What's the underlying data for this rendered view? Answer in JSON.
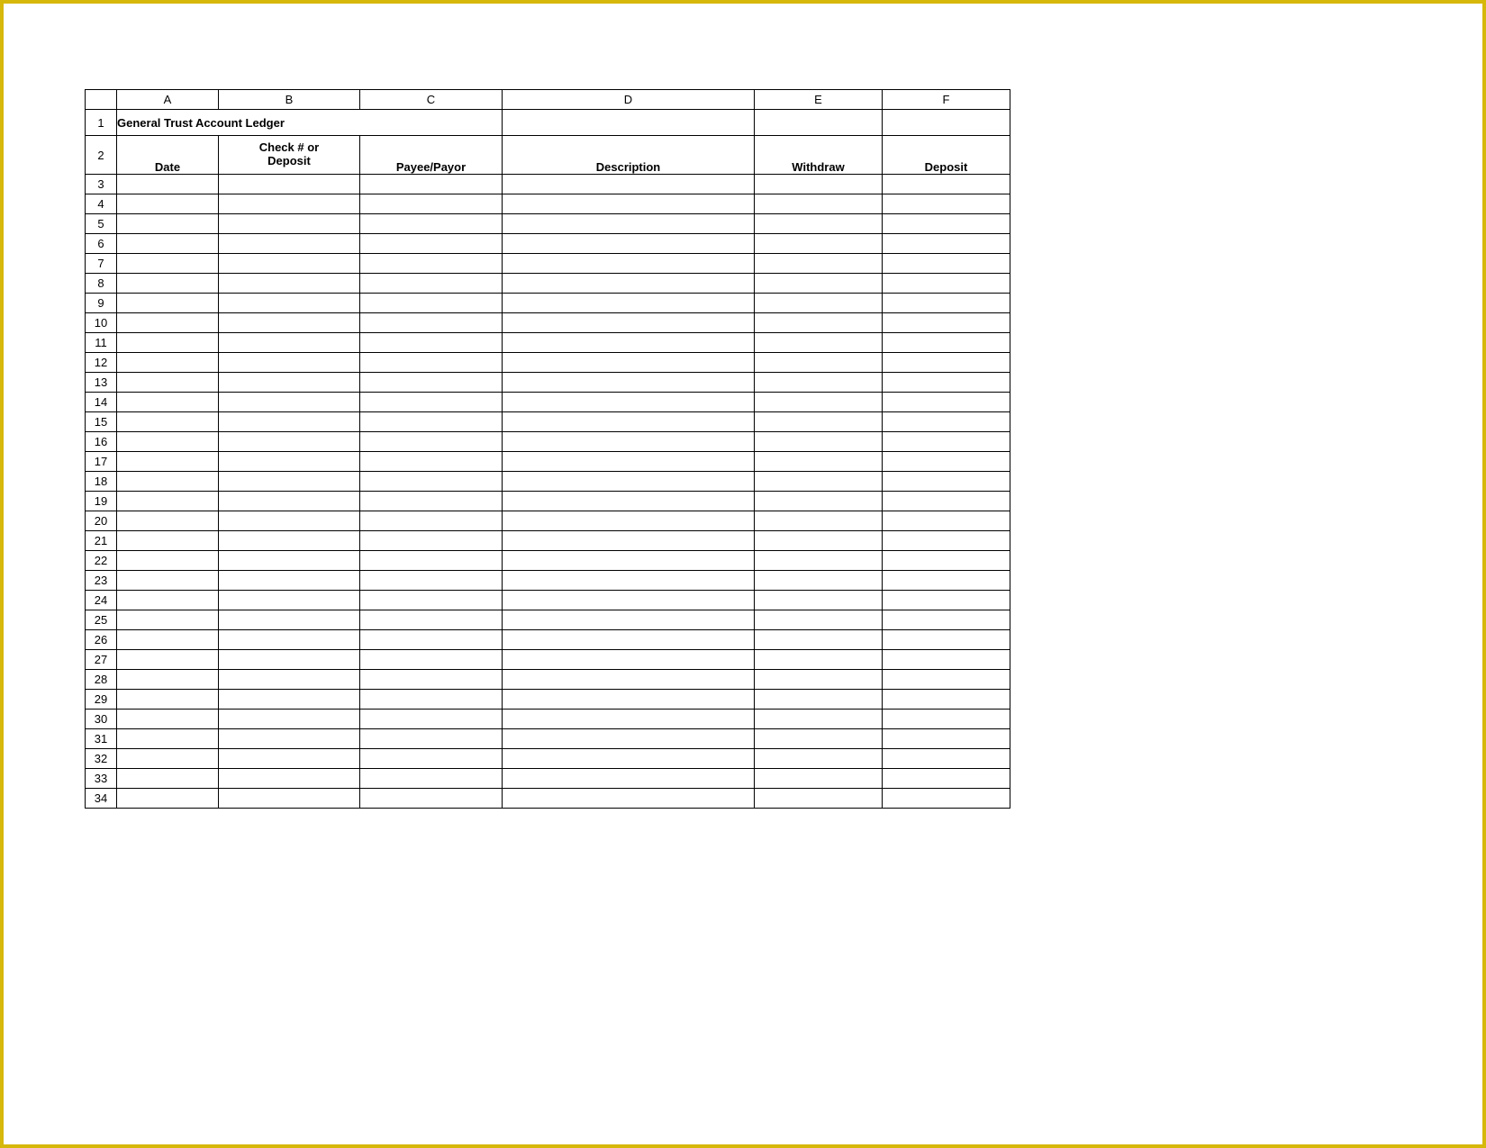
{
  "columnLetters": [
    "A",
    "B",
    "C",
    "D",
    "E",
    "F"
  ],
  "title": "General Trust Account Ledger",
  "headers": {
    "A": "Date",
    "B": "Check # or\nDeposit",
    "C": "Payee/Payor",
    "D": "Description",
    "E": "Withdraw",
    "F": "Deposit"
  },
  "rowNumbers": {
    "title": "1",
    "header": "2",
    "dataStart": 3,
    "dataEnd": 34
  },
  "rows": [
    {
      "A": "",
      "B": "",
      "C": "",
      "D": "",
      "E": "",
      "F": ""
    },
    {
      "A": "",
      "B": "",
      "C": "",
      "D": "",
      "E": "",
      "F": ""
    },
    {
      "A": "",
      "B": "",
      "C": "",
      "D": "",
      "E": "",
      "F": ""
    },
    {
      "A": "",
      "B": "",
      "C": "",
      "D": "",
      "E": "",
      "F": ""
    },
    {
      "A": "",
      "B": "",
      "C": "",
      "D": "",
      "E": "",
      "F": ""
    },
    {
      "A": "",
      "B": "",
      "C": "",
      "D": "",
      "E": "",
      "F": ""
    },
    {
      "A": "",
      "B": "",
      "C": "",
      "D": "",
      "E": "",
      "F": ""
    },
    {
      "A": "",
      "B": "",
      "C": "",
      "D": "",
      "E": "",
      "F": ""
    },
    {
      "A": "",
      "B": "",
      "C": "",
      "D": "",
      "E": "",
      "F": ""
    },
    {
      "A": "",
      "B": "",
      "C": "",
      "D": "",
      "E": "",
      "F": ""
    },
    {
      "A": "",
      "B": "",
      "C": "",
      "D": "",
      "E": "",
      "F": ""
    },
    {
      "A": "",
      "B": "",
      "C": "",
      "D": "",
      "E": "",
      "F": ""
    },
    {
      "A": "",
      "B": "",
      "C": "",
      "D": "",
      "E": "",
      "F": ""
    },
    {
      "A": "",
      "B": "",
      "C": "",
      "D": "",
      "E": "",
      "F": ""
    },
    {
      "A": "",
      "B": "",
      "C": "",
      "D": "",
      "E": "",
      "F": ""
    },
    {
      "A": "",
      "B": "",
      "C": "",
      "D": "",
      "E": "",
      "F": ""
    },
    {
      "A": "",
      "B": "",
      "C": "",
      "D": "",
      "E": "",
      "F": ""
    },
    {
      "A": "",
      "B": "",
      "C": "",
      "D": "",
      "E": "",
      "F": ""
    },
    {
      "A": "",
      "B": "",
      "C": "",
      "D": "",
      "E": "",
      "F": ""
    },
    {
      "A": "",
      "B": "",
      "C": "",
      "D": "",
      "E": "",
      "F": ""
    },
    {
      "A": "",
      "B": "",
      "C": "",
      "D": "",
      "E": "",
      "F": ""
    },
    {
      "A": "",
      "B": "",
      "C": "",
      "D": "",
      "E": "",
      "F": ""
    },
    {
      "A": "",
      "B": "",
      "C": "",
      "D": "",
      "E": "",
      "F": ""
    },
    {
      "A": "",
      "B": "",
      "C": "",
      "D": "",
      "E": "",
      "F": ""
    },
    {
      "A": "",
      "B": "",
      "C": "",
      "D": "",
      "E": "",
      "F": ""
    },
    {
      "A": "",
      "B": "",
      "C": "",
      "D": "",
      "E": "",
      "F": ""
    },
    {
      "A": "",
      "B": "",
      "C": "",
      "D": "",
      "E": "",
      "F": ""
    },
    {
      "A": "",
      "B": "",
      "C": "",
      "D": "",
      "E": "",
      "F": ""
    },
    {
      "A": "",
      "B": "",
      "C": "",
      "D": "",
      "E": "",
      "F": ""
    },
    {
      "A": "",
      "B": "",
      "C": "",
      "D": "",
      "E": "",
      "F": ""
    },
    {
      "A": "",
      "B": "",
      "C": "",
      "D": "",
      "E": "",
      "F": ""
    },
    {
      "A": "",
      "B": "",
      "C": "",
      "D": "",
      "E": "",
      "F": ""
    }
  ]
}
